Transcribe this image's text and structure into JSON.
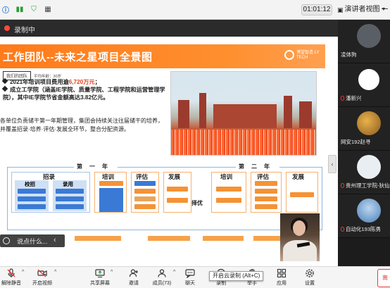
{
  "topbar": {
    "timer": "01:01:12",
    "presenter_view_label": "演讲者视图"
  },
  "recording": {
    "label": "录制中"
  },
  "slide": {
    "title": "工作团队--未来之星项目全景图",
    "logo_text": "博望智造 LY TECH",
    "tag_team": "我们的团队",
    "tag_age": "平均年龄：30岁",
    "bullet1_prefix": "2021年培训项目费用逾",
    "bullet1_highlight": "6,720万元",
    "bullet1_suffix": "；",
    "bullet2": "成立工学院（涵盖IE学院、质量学院、工程学院和运营管理学院），其中IE学院节省金额高达3.82亿元。",
    "description": "各单位负责储干第一年期管理，集团会持续关注往届储干的培养，并覆盖招录·培养·评估·发展全环节，整合分配资源。",
    "diagram": {
      "year1": "第一年",
      "year2": "第二年",
      "upgrade": "择优",
      "groups_y1": [
        "招录",
        "培训",
        "评估",
        "发展"
      ],
      "groups_y2": [
        "培训",
        "评估",
        "发展"
      ],
      "recruit_sub": [
        "校招",
        "录用"
      ]
    }
  },
  "comment": {
    "placeholder": "说点什么..."
  },
  "participants": [
    {
      "name": "凌体狗"
    },
    {
      "name": "潘新兴"
    },
    {
      "name": "网安192赵寻"
    },
    {
      "name": "贵州理工学院-狄仙"
    },
    {
      "name": "自动化193陈勇"
    }
  ],
  "toolbar": {
    "mute_label": "解除静音",
    "video_label": "开启视频",
    "share_label": "共享屏幕",
    "invite_label": "邀请",
    "members_label": "成员(73)",
    "chat_label": "聊天",
    "record_label": "录制",
    "raise_hand_label": "举手",
    "apps_label": "应用",
    "settings_label": "设置",
    "tooltip": "开启云录制 (Alt+C)",
    "end_label": "离"
  },
  "colors": {
    "accent_orange": "#ff7a1a",
    "highlight_red": "#e8421b",
    "recording_red": "#ff4a3d",
    "diagram_blue": "#3a7ad5"
  }
}
